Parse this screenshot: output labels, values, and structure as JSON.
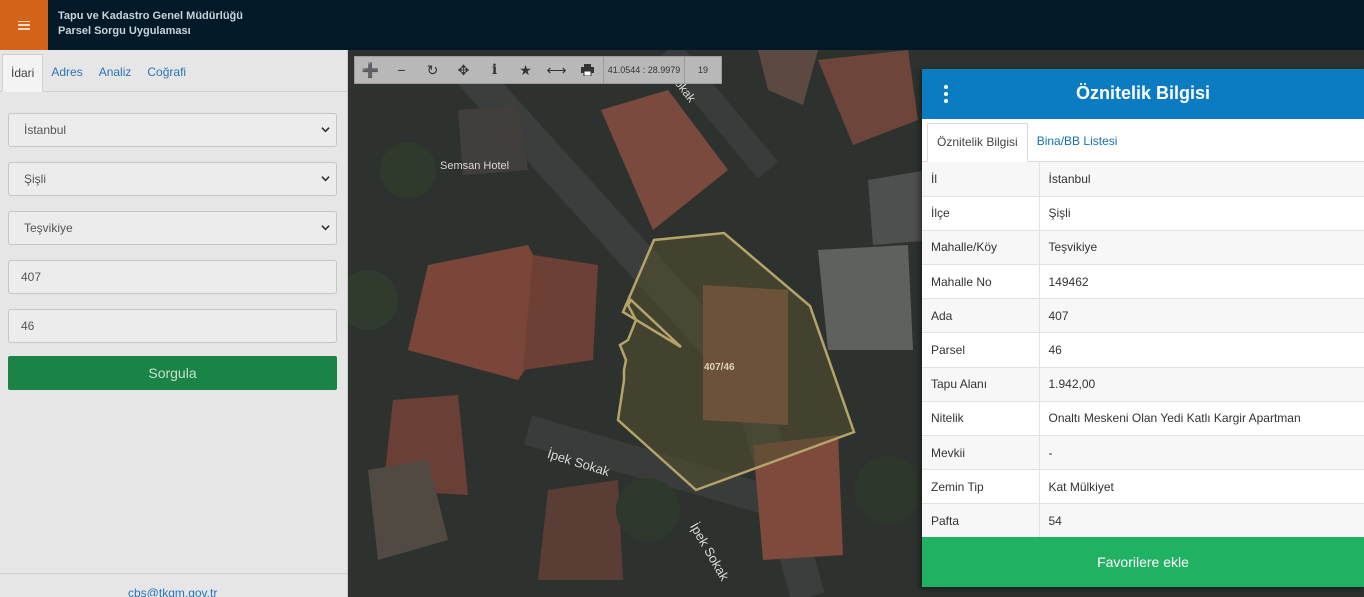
{
  "header": {
    "menu_icon": "hamburger-icon",
    "title_line1": "Tapu ve Kadastro Genel Müdürlüğü",
    "title_line2": "Parsel Sorgu Uygulaması",
    "accent_color": "#d4631a",
    "bg_color": "#021a28"
  },
  "left_panel": {
    "tabs": [
      {
        "label": "İdari",
        "active": true
      },
      {
        "label": "Adres",
        "active": false
      },
      {
        "label": "Analiz",
        "active": false
      },
      {
        "label": "Coğrafi",
        "active": false
      }
    ],
    "il_select": "İstanbul",
    "ilce_select": "Şişli",
    "mahalle_select": "Teşvikiye",
    "ada_input": "407",
    "parsel_input": "46",
    "submit_label": "Sorgula",
    "submit_color": "#1a8447",
    "footer_email": "cbs@tkgm.gov.tr"
  },
  "map": {
    "toolbar": {
      "zoom_in_icon": "plus-icon",
      "zoom_out_icon": "minus-icon",
      "refresh_icon": "refresh-icon",
      "pan_icon": "move-icon",
      "info_icon": "info-icon",
      "favorite_icon": "star-icon",
      "measure_icon": "measure-icon",
      "print_icon": "print-icon",
      "coordinates": "41.0544 : 28.9979",
      "zoom_level": "19"
    },
    "labels": {
      "hotel": "Semsan Hotel",
      "street1": "İpek Sokak",
      "street2": "İpek Sokak",
      "street3": "Sokak",
      "parcel": "407/46"
    }
  },
  "attribute_panel": {
    "title": "Öznitelik Bilgisi",
    "header_color": "#0b7bc2",
    "tabs": [
      {
        "label": "Öznitelik Bilgisi",
        "active": true
      },
      {
        "label": "Bina/BB Listesi",
        "active": false
      }
    ],
    "rows": [
      {
        "key": "İl",
        "value": "İstanbul"
      },
      {
        "key": "İlçe",
        "value": "Şişli"
      },
      {
        "key": "Mahalle/Köy",
        "value": "Teşvikiye"
      },
      {
        "key": "Mahalle No",
        "value": "149462"
      },
      {
        "key": "Ada",
        "value": "407"
      },
      {
        "key": "Parsel",
        "value": "46"
      },
      {
        "key": "Tapu Alanı",
        "value": "1.942,00"
      },
      {
        "key": "Nitelik",
        "value": "Onaltı Meskeni Olan Yedi Katlı Kargir Apartman"
      },
      {
        "key": "Mevkii",
        "value": "-"
      },
      {
        "key": "Zemin Tip",
        "value": "Kat Mülkiyet"
      },
      {
        "key": "Pafta",
        "value": "54"
      }
    ],
    "favorite_label": "Favorilere ekle",
    "favorite_color": "#20b163"
  }
}
